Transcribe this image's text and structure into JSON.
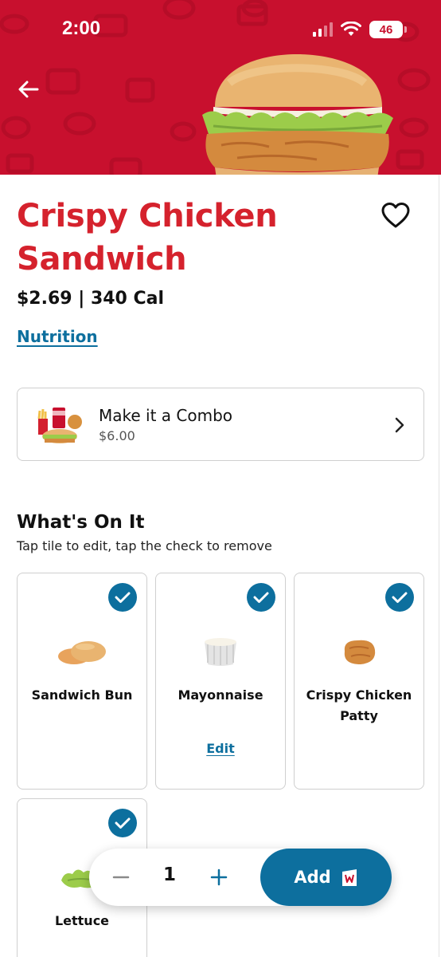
{
  "status_bar": {
    "time": "2:00",
    "battery": "46"
  },
  "product": {
    "title": "Crispy Chicken Sandwich",
    "price_line": "$2.69 | 340 Cal",
    "nutrition_link": "Nutrition"
  },
  "combo": {
    "title": "Make it a Combo",
    "price": "$6.00"
  },
  "whats_on_it": {
    "title": "What's On It",
    "subtitle": "Tap tile to edit, tap the check to remove",
    "items": [
      {
        "label": "Sandwich Bun",
        "checked": true
      },
      {
        "label": "Mayonnaise",
        "checked": true,
        "edit_label": "Edit"
      },
      {
        "label": "Crispy Chicken Patty",
        "checked": true
      },
      {
        "label": "Lettuce",
        "checked": true
      }
    ]
  },
  "order_bar": {
    "quantity": "1",
    "add_label": "Add"
  },
  "colors": {
    "brand_red": "#c8102e",
    "title_red": "#d5222d",
    "accent_blue": "#0d6f9e"
  },
  "icons": [
    "back-arrow-icon",
    "heart-icon",
    "chevron-right-icon",
    "check-icon",
    "minus-icon",
    "plus-icon",
    "bag-icon",
    "wifi-icon",
    "signal-icon"
  ]
}
